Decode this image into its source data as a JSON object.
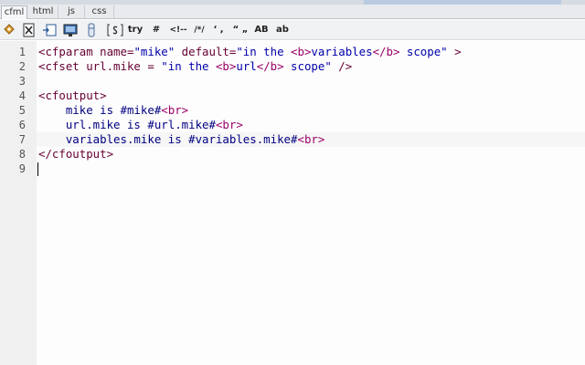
{
  "tabs": [
    {
      "label": "cfml",
      "active": true
    },
    {
      "label": "html",
      "active": false
    },
    {
      "label": "js",
      "active": false
    },
    {
      "label": "css",
      "active": false
    }
  ],
  "toolbar": {
    "try_label": "try",
    "hash_label": "#",
    "html_comment_label": "<!--",
    "cf_comment_label": "/*/",
    "single_quote_label": "‘ ,",
    "double_quote_label": "“ „",
    "uppercase_label": "AB",
    "lowercase_label": "ab"
  },
  "editor": {
    "line_numbers": [
      "1",
      "2",
      "3",
      "4",
      "5",
      "6",
      "7",
      "8",
      "9"
    ],
    "lines": [
      [
        {
          "text": "<cfparam name=",
          "kind": "tag"
        },
        {
          "text": "\"mike\"",
          "kind": "string"
        },
        {
          "text": " default=",
          "kind": "tag"
        },
        {
          "text": "\"in the ",
          "kind": "string"
        },
        {
          "text": "<b>",
          "kind": "html"
        },
        {
          "text": "variables",
          "kind": "string"
        },
        {
          "text": "</b>",
          "kind": "html"
        },
        {
          "text": " scope\"",
          "kind": "string"
        },
        {
          "text": " >",
          "kind": "tag"
        }
      ],
      [
        {
          "text": "<cfset url.mike = ",
          "kind": "tag"
        },
        {
          "text": "\"in the ",
          "kind": "string"
        },
        {
          "text": "<b>",
          "kind": "html"
        },
        {
          "text": "url",
          "kind": "string"
        },
        {
          "text": "</b>",
          "kind": "html"
        },
        {
          "text": " scope\"",
          "kind": "string"
        },
        {
          "text": " />",
          "kind": "tag"
        }
      ],
      [],
      [
        {
          "text": "<cfoutput>",
          "kind": "tag"
        }
      ],
      [
        {
          "text": "    mike is #mike#",
          "kind": "text"
        },
        {
          "text": "<br>",
          "kind": "html"
        }
      ],
      [
        {
          "text": "    url.mike is #url.mike#",
          "kind": "text"
        },
        {
          "text": "<br>",
          "kind": "html"
        }
      ],
      [
        {
          "text": "    variables.mike is #variables.mike#",
          "kind": "text"
        },
        {
          "text": "<br>",
          "kind": "html"
        }
      ],
      [
        {
          "text": "</cfoutput>",
          "kind": "tag"
        }
      ],
      []
    ]
  },
  "colors": {
    "tag": "#660033",
    "string": "#0000aa",
    "html": "#990066",
    "text": "#000080"
  },
  "icons": [
    "tag-chooser-icon",
    "cfml-doc-icon",
    "cfmodule-icon",
    "monitor-icon",
    "cfquery-icon",
    "cfscript-icon"
  ]
}
